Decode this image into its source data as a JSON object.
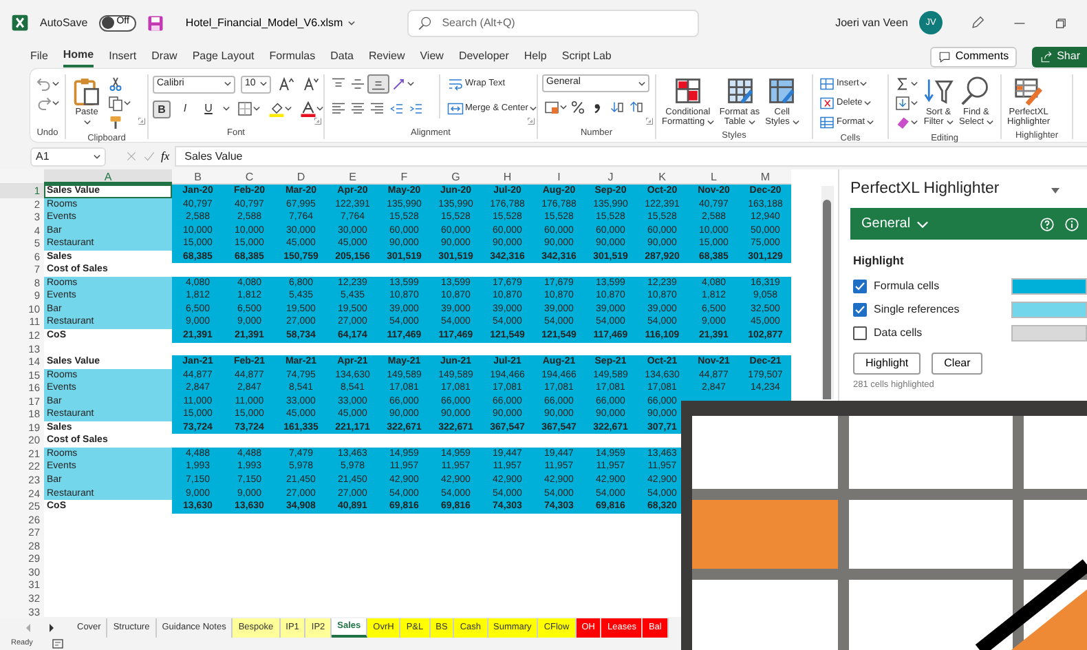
{
  "title_bar": {
    "autosave_label": "AutoSave",
    "autosave": {
      "label": "Off",
      "on": false
    },
    "file_name": "Hotel_Financial_Model_V6.xlsm",
    "search": {
      "placeholder": "Search (Alt+Q)"
    },
    "user_name": "Joeri van Veen",
    "avatar": "JV"
  },
  "menu": [
    {
      "label": "File",
      "selected": false
    },
    {
      "label": "Home",
      "selected": true
    },
    {
      "label": "Insert",
      "selected": false
    },
    {
      "label": "Draw",
      "selected": false
    },
    {
      "label": "Page Layout",
      "selected": false
    },
    {
      "label": "Formulas",
      "selected": false
    },
    {
      "label": "Data",
      "selected": false
    },
    {
      "label": "Review",
      "selected": false
    },
    {
      "label": "View",
      "selected": false
    },
    {
      "label": "Developer",
      "selected": false
    },
    {
      "label": "Help",
      "selected": false
    },
    {
      "label": "Script Lab",
      "selected": false
    }
  ],
  "comments": "Comments",
  "share": "Shar",
  "ribbon": [
    {
      "kind": "undo",
      "label": "Undo"
    },
    {
      "kind": "clipboard",
      "label": "Clipboard",
      "paste": "Paste"
    },
    {
      "kind": "font",
      "label": "Font",
      "font": "Calibri",
      "size": "10",
      "styles": [
        {
          "text": "B",
          "selected": true
        },
        {
          "text": "I",
          "selected": false
        },
        {
          "text": "U",
          "selected": false
        }
      ]
    },
    {
      "kind": "alignment",
      "label": "Alignment",
      "vertical": [
        {
          "selected": false
        },
        {
          "selected": false
        },
        {
          "selected": true
        }
      ],
      "wrap": "Wrap Text",
      "merge": "Merge & Center"
    },
    {
      "kind": "number",
      "label": "Number",
      "format": "General"
    },
    {
      "kind": "large",
      "label": "Styles",
      "buttons": [
        {
          "lines": [
            "Conditional",
            "Formatting"
          ],
          "dropdown": true
        },
        {
          "lines": [
            "Format as",
            "Table"
          ],
          "dropdown": true
        },
        {
          "lines": [
            "Cell",
            "Styles"
          ],
          "dropdown": true
        }
      ]
    },
    {
      "kind": "cells",
      "label": "Cells",
      "buttons": [
        "Insert",
        "Delete",
        "Format"
      ]
    },
    {
      "kind": "editing",
      "label": "Editing",
      "buttons": [
        {
          "lines": [
            "Sort &",
            "Filter"
          ],
          "dropdown": true
        },
        {
          "lines": [
            "Find &",
            "Select"
          ],
          "dropdown": true
        }
      ]
    },
    {
      "kind": "large",
      "label": "Highlighter",
      "buttons": [
        {
          "lines": [
            "PerfectXL",
            "Highlighter"
          ],
          "dropdown": false
        }
      ]
    }
  ],
  "formula_bar": {
    "name_box": "A1",
    "fx": "fx",
    "formula": "Sales Value"
  },
  "sheet": {
    "columns": [
      {
        "label": "A",
        "selected": true
      },
      {
        "label": "B",
        "selected": false
      },
      {
        "label": "C",
        "selected": false
      },
      {
        "label": "D",
        "selected": false
      },
      {
        "label": "E",
        "selected": false
      },
      {
        "label": "F",
        "selected": false
      },
      {
        "label": "G",
        "selected": false
      },
      {
        "label": "H",
        "selected": false
      },
      {
        "label": "I",
        "selected": false
      },
      {
        "label": "J",
        "selected": false
      },
      {
        "label": "K",
        "selected": false
      },
      {
        "label": "L",
        "selected": false
      },
      {
        "label": "M",
        "selected": false
      }
    ],
    "rows": [
      {
        "number": "1",
        "kind": "header",
        "selected": true,
        "cells": [
          "Sales Value",
          "Jan-20",
          "Feb-20",
          "Mar-20",
          "Apr-20",
          "May-20",
          "Jun-20",
          "Jul-20",
          "Aug-20",
          "Sep-20",
          "Oct-20",
          "Nov-20",
          "Dec-20"
        ]
      },
      {
        "number": "2",
        "kind": "item",
        "selected": false,
        "cells": [
          "Rooms",
          "40,797",
          "40,797",
          "67,995",
          "122,391",
          "135,990",
          "135,990",
          "176,788",
          "176,788",
          "135,990",
          "122,391",
          "40,797",
          "163,188"
        ]
      },
      {
        "number": "3",
        "kind": "item",
        "selected": false,
        "cells": [
          "Events",
          "2,588",
          "2,588",
          "7,764",
          "7,764",
          "15,528",
          "15,528",
          "15,528",
          "15,528",
          "15,528",
          "15,528",
          "2,588",
          "12,940"
        ]
      },
      {
        "number": "4",
        "kind": "item",
        "selected": false,
        "cells": [
          "Bar",
          "10,000",
          "10,000",
          "30,000",
          "30,000",
          "60,000",
          "60,000",
          "60,000",
          "60,000",
          "60,000",
          "60,000",
          "10,000",
          "50,000"
        ]
      },
      {
        "number": "5",
        "kind": "item",
        "selected": false,
        "cells": [
          "Restaurant",
          "15,000",
          "15,000",
          "45,000",
          "45,000",
          "90,000",
          "90,000",
          "90,000",
          "90,000",
          "90,000",
          "90,000",
          "15,000",
          "75,000"
        ]
      },
      {
        "number": "6",
        "kind": "total",
        "selected": false,
        "cells": [
          "Sales",
          "68,385",
          "68,385",
          "150,759",
          "205,156",
          "301,519",
          "301,519",
          "342,316",
          "342,316",
          "301,519",
          "287,920",
          "68,385",
          "301,129"
        ]
      },
      {
        "number": "7",
        "kind": "section",
        "selected": false,
        "cells": [
          "Cost of Sales"
        ]
      },
      {
        "number": "8",
        "kind": "item",
        "selected": false,
        "cells": [
          "Rooms",
          "4,080",
          "4,080",
          "6,800",
          "12,239",
          "13,599",
          "13,599",
          "17,679",
          "17,679",
          "13,599",
          "12,239",
          "4,080",
          "16,319"
        ]
      },
      {
        "number": "9",
        "kind": "item",
        "selected": false,
        "cells": [
          "Events",
          "1,812",
          "1,812",
          "5,435",
          "5,435",
          "10,870",
          "10,870",
          "10,870",
          "10,870",
          "10,870",
          "10,870",
          "1,812",
          "9,058"
        ]
      },
      {
        "number": "10",
        "kind": "item",
        "selected": false,
        "cells": [
          "Bar",
          "6,500",
          "6,500",
          "19,500",
          "19,500",
          "39,000",
          "39,000",
          "39,000",
          "39,000",
          "39,000",
          "39,000",
          "6,500",
          "32,500"
        ]
      },
      {
        "number": "11",
        "kind": "item",
        "selected": false,
        "cells": [
          "Restaurant",
          "9,000",
          "9,000",
          "27,000",
          "27,000",
          "54,000",
          "54,000",
          "54,000",
          "54,000",
          "54,000",
          "54,000",
          "9,000",
          "45,000"
        ]
      },
      {
        "number": "12",
        "kind": "total",
        "selected": false,
        "cells": [
          "CoS",
          "21,391",
          "21,391",
          "58,734",
          "64,174",
          "117,469",
          "117,469",
          "121,549",
          "121,549",
          "117,469",
          "116,109",
          "21,391",
          "102,877"
        ]
      },
      {
        "number": "13",
        "kind": "blank",
        "selected": false
      },
      {
        "number": "14",
        "kind": "header",
        "selected": false,
        "cells": [
          "Sales Value",
          "Jan-21",
          "Feb-21",
          "Mar-21",
          "Apr-21",
          "May-21",
          "Jun-21",
          "Jul-21",
          "Aug-21",
          "Sep-21",
          "Oct-21",
          "Nov-21",
          "Dec-21"
        ]
      },
      {
        "number": "15",
        "kind": "item",
        "selected": false,
        "cells": [
          "Rooms",
          "44,877",
          "44,877",
          "74,795",
          "134,630",
          "149,589",
          "149,589",
          "194,466",
          "194,466",
          "149,589",
          "134,630",
          "44,877",
          "179,507"
        ]
      },
      {
        "number": "16",
        "kind": "item",
        "selected": false,
        "cells": [
          "Events",
          "2,847",
          "2,847",
          "8,541",
          "8,541",
          "17,081",
          "17,081",
          "17,081",
          "17,081",
          "17,081",
          "17,081",
          "2,847",
          "14,234"
        ]
      },
      {
        "number": "17",
        "kind": "item",
        "selected": false,
        "cells": [
          "Bar",
          "11,000",
          "11,000",
          "33,000",
          "33,000",
          "66,000",
          "66,000",
          "66,000",
          "66,000",
          "66,000",
          "66,000"
        ]
      },
      {
        "number": "18",
        "kind": "item",
        "selected": false,
        "cells": [
          "Restaurant",
          "15,000",
          "15,000",
          "45,000",
          "45,000",
          "90,000",
          "90,000",
          "90,000",
          "90,000",
          "90,000",
          "90,000"
        ]
      },
      {
        "number": "19",
        "kind": "total",
        "selected": false,
        "cells": [
          "Sales",
          "73,724",
          "73,724",
          "161,335",
          "221,171",
          "322,671",
          "322,671",
          "367,547",
          "367,547",
          "322,671",
          "307,71"
        ]
      },
      {
        "number": "20",
        "kind": "section",
        "selected": false,
        "cells": [
          "Cost of Sales"
        ]
      },
      {
        "number": "21",
        "kind": "item",
        "selected": false,
        "cells": [
          "Rooms",
          "4,488",
          "4,488",
          "7,479",
          "13,463",
          "14,959",
          "14,959",
          "19,447",
          "19,447",
          "14,959",
          "13,463"
        ]
      },
      {
        "number": "22",
        "kind": "item",
        "selected": false,
        "cells": [
          "Events",
          "1,993",
          "1,993",
          "5,978",
          "5,978",
          "11,957",
          "11,957",
          "11,957",
          "11,957",
          "11,957",
          "11,957"
        ]
      },
      {
        "number": "23",
        "kind": "item",
        "selected": false,
        "cells": [
          "Bar",
          "7,150",
          "7,150",
          "21,450",
          "21,450",
          "42,900",
          "42,900",
          "42,900",
          "42,900",
          "42,900",
          "42,900"
        ]
      },
      {
        "number": "24",
        "kind": "item",
        "selected": false,
        "cells": [
          "Restaurant",
          "9,000",
          "9,000",
          "27,000",
          "27,000",
          "54,000",
          "54,000",
          "54,000",
          "54,000",
          "54,000",
          "54,000"
        ]
      },
      {
        "number": "25",
        "kind": "total",
        "selected": false,
        "cells": [
          "CoS",
          "13,630",
          "13,630",
          "34,908",
          "40,891",
          "69,816",
          "69,816",
          "74,303",
          "74,303",
          "69,816",
          "68,320"
        ]
      },
      {
        "number": "26",
        "kind": "blank",
        "selected": false
      },
      {
        "number": "27",
        "kind": "blank",
        "selected": false
      },
      {
        "number": "28",
        "kind": "blank",
        "selected": false
      },
      {
        "number": "29",
        "kind": "blank",
        "selected": false
      },
      {
        "number": "30",
        "kind": "blank",
        "selected": false
      },
      {
        "number": "31",
        "kind": "blank",
        "selected": false
      },
      {
        "number": "32",
        "kind": "blank",
        "selected": false
      },
      {
        "number": "33",
        "kind": "blank",
        "selected": false
      }
    ]
  },
  "pane": {
    "title": "PerfectXL Highlighter",
    "section": "General",
    "heading": "Highlight",
    "options": [
      {
        "label": "Formula cells",
        "checked": true,
        "color": "#00b0d8"
      },
      {
        "label": "Single references",
        "checked": true,
        "color": "#74d6ea"
      },
      {
        "label": "Data cells",
        "checked": false,
        "color": "#d9d9d9"
      }
    ],
    "buttons": [
      "Highlight",
      "Clear"
    ],
    "status": "281 cells highlighted"
  },
  "sheet_tabs": [
    {
      "label": "Cover",
      "selected": false
    },
    {
      "label": "Structure",
      "selected": false
    },
    {
      "label": "Guidance Notes",
      "selected": false
    },
    {
      "label": "Bespoke",
      "selected": false,
      "color": "#ffff99"
    },
    {
      "label": "IP1",
      "selected": false,
      "color": "#ffff99"
    },
    {
      "label": "IP2",
      "selected": false,
      "color": "#ffff99"
    },
    {
      "label": "Sales",
      "selected": true
    },
    {
      "label": "OvrH",
      "selected": false,
      "color": "#ffff00"
    },
    {
      "label": "P&L",
      "selected": false,
      "color": "#ffff00"
    },
    {
      "label": "BS",
      "selected": false,
      "color": "#ffff00"
    },
    {
      "label": "Cash",
      "selected": false,
      "color": "#ffff00"
    },
    {
      "label": "Summary",
      "selected": false,
      "color": "#ffff00"
    },
    {
      "label": "CFlow",
      "selected": false,
      "color": "#ffff00"
    },
    {
      "label": "OH",
      "selected": false,
      "color": "#ff0000"
    },
    {
      "label": "Leases",
      "selected": false,
      "color": "#ff0000"
    },
    {
      "label": "Bal",
      "selected": false,
      "color": "#ff0000"
    }
  ],
  "status_bar": {
    "text": "Ready"
  }
}
